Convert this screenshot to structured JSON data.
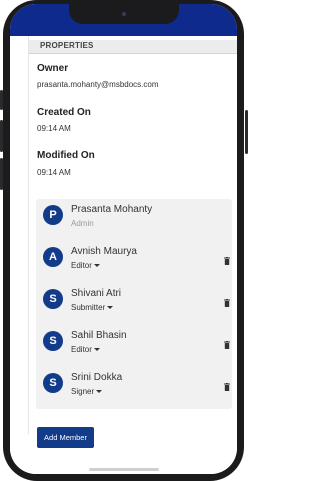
{
  "properties": {
    "header": "PROPERTIES",
    "owner_label": "Owner",
    "owner_value": "prasanta.mohanty@msbdocs.com",
    "created_label": "Created On",
    "created_value": "09:14 AM",
    "modified_label": "Modified On",
    "modified_value": "09:14 AM"
  },
  "members": [
    {
      "initial": "P",
      "name": "Prasanta Mohanty",
      "role": "Admin",
      "has_dropdown": false,
      "has_delete": false
    },
    {
      "initial": "A",
      "name": "Avnish Maurya",
      "role": "Editor",
      "has_dropdown": true,
      "has_delete": true
    },
    {
      "initial": "S",
      "name": "Shivani Atri",
      "role": "Submitter",
      "has_dropdown": true,
      "has_delete": true
    },
    {
      "initial": "S",
      "name": "Sahil Bhasin",
      "role": "Editor",
      "has_dropdown": true,
      "has_delete": true
    },
    {
      "initial": "S",
      "name": "Srini Dokka",
      "role": "Signer",
      "has_dropdown": true,
      "has_delete": true
    }
  ],
  "add_member_label": "Add Member",
  "colors": {
    "brand_blue": "#123b89",
    "status_bar": "#0d2a8c"
  },
  "icons": {
    "delete": "trash-icon",
    "dropdown": "caret-down-icon"
  }
}
